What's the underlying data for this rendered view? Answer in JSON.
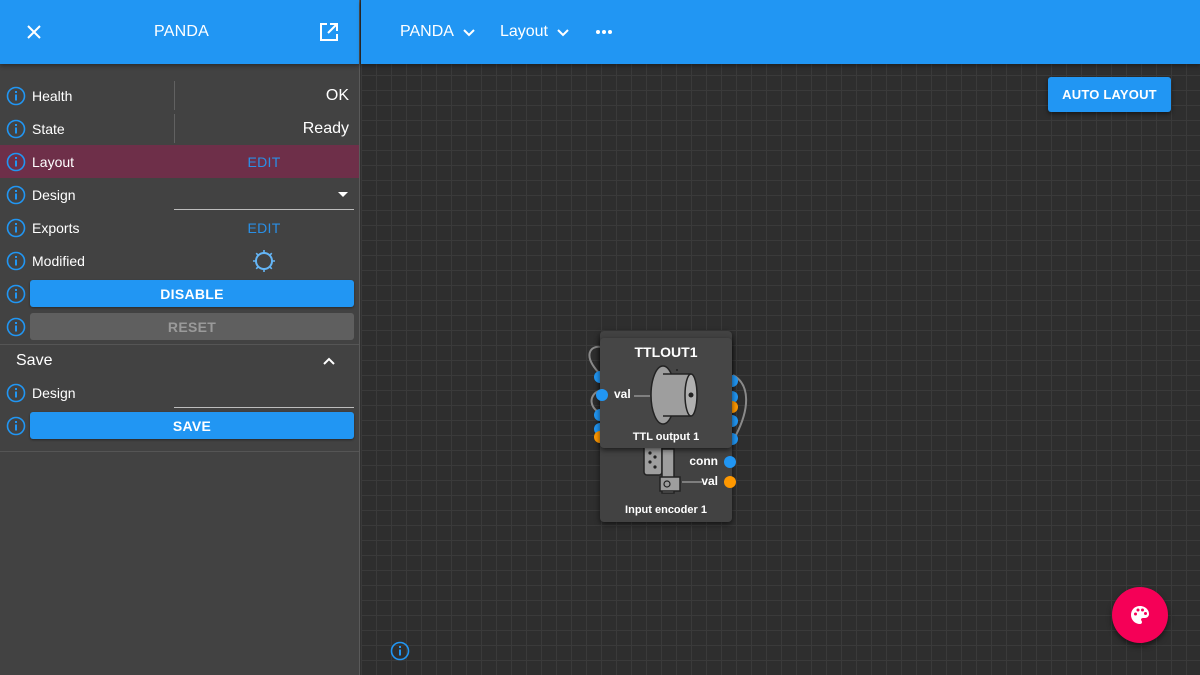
{
  "left_panel": {
    "title": "PANDA",
    "rows": {
      "health": {
        "label": "Health",
        "value": "OK"
      },
      "state": {
        "label": "State",
        "value": "Ready"
      },
      "layout": {
        "label": "Layout",
        "action": "EDIT"
      },
      "design": {
        "label": "Design",
        "value": ""
      },
      "exports": {
        "label": "Exports",
        "action": "EDIT"
      },
      "modified": {
        "label": "Modified"
      },
      "disable": {
        "label": "DISABLE"
      },
      "reset": {
        "label": "RESET"
      }
    },
    "save_section": {
      "title": "Save",
      "design_label": "Design",
      "design_value": "",
      "save_label": "SAVE"
    }
  },
  "right_header": {
    "crumbs": [
      "PANDA",
      "Layout"
    ]
  },
  "canvas": {
    "auto_layout_label": "AUTO LAYOUT",
    "nodes": {
      "ttlout": {
        "title": "TTLOUT1",
        "subtitle": "TTL output 1",
        "in_port": "val"
      },
      "inenc": {
        "subtitle": "Input encoder 1",
        "out_ports": [
          "conn",
          "val"
        ]
      }
    }
  },
  "colors": {
    "accent": "#2196f3",
    "highlight_row": "#6e2f49",
    "fab": "#f50057",
    "port_blue": "#2196f3",
    "port_orange": "#ff9800"
  },
  "icons": [
    "close-icon",
    "open-in-new-icon",
    "info-icon",
    "chevron-down-icon",
    "more-horiz-icon",
    "chevron-up-icon",
    "palette-icon",
    "spinner-icon"
  ]
}
